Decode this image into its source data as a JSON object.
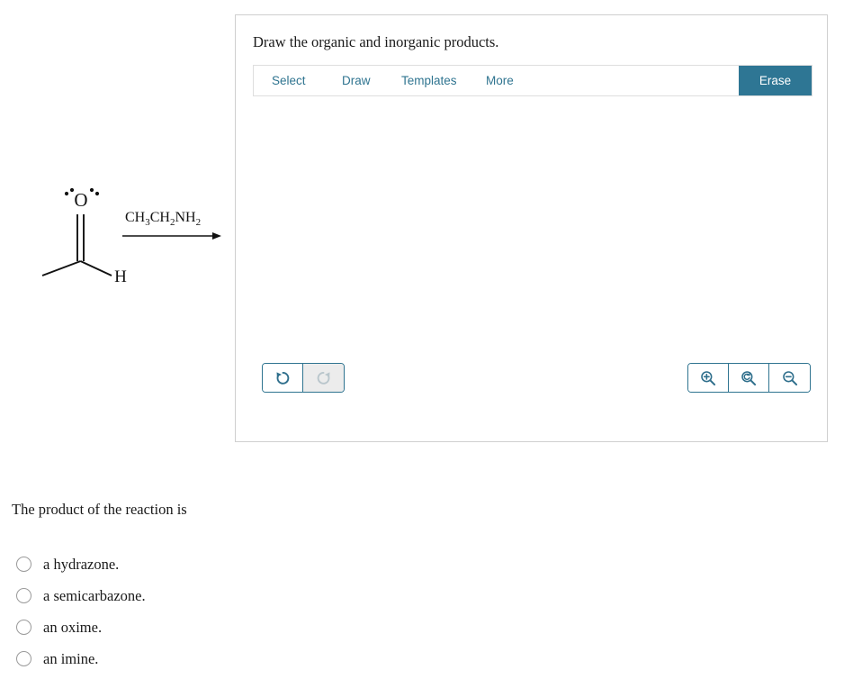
{
  "panel": {
    "prompt": "Draw the organic and inorganic products."
  },
  "toolbar": {
    "items": [
      {
        "label": "Select",
        "name": "select"
      },
      {
        "label": "Draw",
        "name": "draw"
      },
      {
        "label": "Templates",
        "name": "templates"
      },
      {
        "label": "More",
        "name": "more"
      }
    ],
    "erase_label": "Erase",
    "accent_color": "#2e7694",
    "link_color": "#2f7490"
  },
  "history_controls": [
    {
      "name": "undo-button",
      "icon": "undo-icon",
      "enabled": true
    },
    {
      "name": "redo-button",
      "icon": "redo-icon",
      "enabled": false
    }
  ],
  "zoom_controls": [
    {
      "name": "zoom-in-button",
      "icon": "magnifier-plus-icon"
    },
    {
      "name": "zoom-reset-button",
      "icon": "magnifier-reset-icon"
    },
    {
      "name": "zoom-out-button",
      "icon": "magnifier-arrow-icon"
    }
  ],
  "reaction": {
    "reactant": {
      "name": "acetaldehyde",
      "oxygen_label": "O",
      "hydrogen_label": "H",
      "lone_pairs": 2,
      "bond_type": "double"
    },
    "reagent": {
      "formula_parts": [
        {
          "text": "CH",
          "sub": false
        },
        {
          "text": "3",
          "sub": true
        },
        {
          "text": "CH",
          "sub": false
        },
        {
          "text": "2",
          "sub": true
        },
        {
          "text": "NH",
          "sub": false
        },
        {
          "text": "2",
          "sub": true
        }
      ],
      "plain": "CH3CH2NH2"
    },
    "arrow": "reaction-arrow-right"
  },
  "question": {
    "stem": "The product of the reaction is",
    "choices": [
      {
        "label": "a hydrazone.",
        "selected": false
      },
      {
        "label": "a semicarbazone.",
        "selected": false
      },
      {
        "label": "an oxime.",
        "selected": false
      },
      {
        "label": "an imine.",
        "selected": false
      }
    ]
  }
}
